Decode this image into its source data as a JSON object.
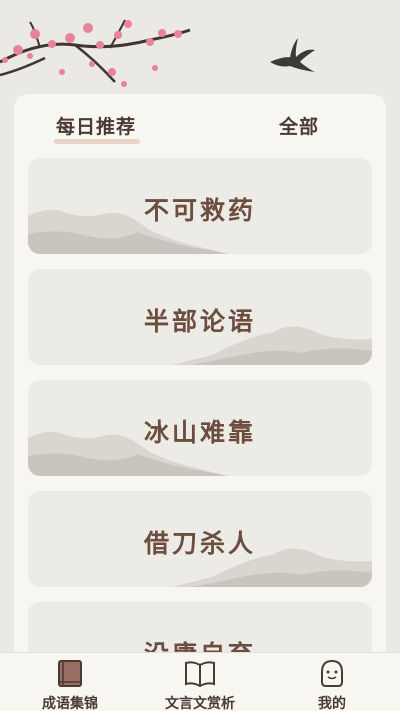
{
  "tabs": {
    "daily": "每日推荐",
    "all": "全部"
  },
  "cards": [
    {
      "title": "不可救药"
    },
    {
      "title": "半部论语"
    },
    {
      "title": "冰山难靠"
    },
    {
      "title": "借刀杀人"
    },
    {
      "title": "没庸自弃"
    }
  ],
  "nav": {
    "idioms": "成语集锦",
    "classics": "文言文赏析",
    "mine": "我的"
  },
  "colors": {
    "accent": "#6b4e3f",
    "tab_underline": "#e8d3c9",
    "blossom": "#e8849a",
    "background": "#ebe9e3"
  },
  "icons": {
    "idioms": "book-icon",
    "classics": "open-book-icon",
    "mine": "user-icon"
  }
}
